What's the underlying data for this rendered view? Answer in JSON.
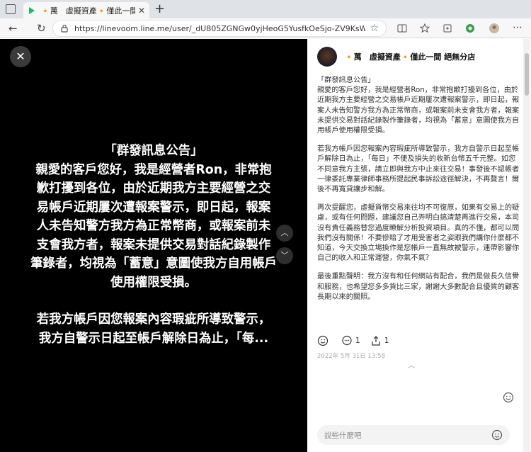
{
  "browser": {
    "tab_title": "🔸萬　虛擬資產🔸僅此一間 絕無分店",
    "tab_close": "✕",
    "new_tab": "+",
    "url": "https://linevoom.line.me/user/_dU805ZGNGw0yjHeoG5YusfkOeSjo-ZV9KsWWr...",
    "back": "←",
    "forward": "→",
    "reload": "↻"
  },
  "viewer": {
    "close": "✕",
    "poster_lines": [
      "「群發訊息公告」",
      "親愛的客戶您好，我是經營者Ron，非常抱",
      "歉打擾到各位，由於近期我方主要經營之交",
      "易帳戶近期屢次遭報案警示，即日起，報案",
      "人未告知警方我方為正常幣商，或報案前未",
      "支會我方者，報案未提供交易對話紀錄製作",
      "筆錄者，均視為「蓄意」意圖使我方自用帳戶",
      "使用權限受損。"
    ],
    "poster_lines_2": [
      "若我方帳戶因您報案內容瑕疵所導致警示，",
      "我方自警示日起至帳戶解除日為止，「每..."
    ],
    "arrow_up": "︿",
    "arrow_down": "﹀"
  },
  "panel": {
    "page_name": "🔸萬　虛擬資產🔸僅此一間 絕無分店",
    "post_paragraphs": [
      "「群發訊息公告」\n親愛的客戶您好，我是經營者Ron，非常抱歉打擾到各位，由於近期我方主要經營之交易帳戶近期屢次遭報案警示，即日起，報案人未告知警方我方為正常幣商，或報案前未支會我方者，報案未提供交易對話紀錄製作筆錄者，均視為「蓄意」意圖使我方自用帳戶使用權限受損。",
      "若我方帳戶因您報案內容瑕疵所導致警示，我方自警示日起至帳戶解除日為止，「每日」不便及損失的收新台幣五千元整。如您不同意我方主張，請立即與我方中止來往交易！事發後不認帳者一律委託專業律師事務所提起民事訴訟途徑解決，不再贅言！爾後不再寬貸讓步和解。",
      "再次提醒您，虛擬貨幣交易來往均不可復原，如果有交易上的疑慮，或有任何問題，建議您自己弄明白搞清楚再進行交易，本司沒有責任義務替您過度瞭解分析投資項目。真的不懂，都可以問我們沒有關係！不要慘賠了才用受害者之姿跟我們講你什麼都不知道，今天交換立場換作是您帳戶一直無故被警示，連帶影響你自己的收入和正常運營，你氣不氣？",
      "最後重點聲明：我方沒有和任何網站有配合，我們是做長久信譽和服務，也希望您多多貨比三家，謝謝大多數配合且優質的顧客長期以來的關照。"
    ],
    "comment_count": "1",
    "share_count": "1",
    "timestamp": "2022年 5月 31日 13:58",
    "scroll_up": "︿",
    "composer_placeholder": "說些什麼吧"
  }
}
